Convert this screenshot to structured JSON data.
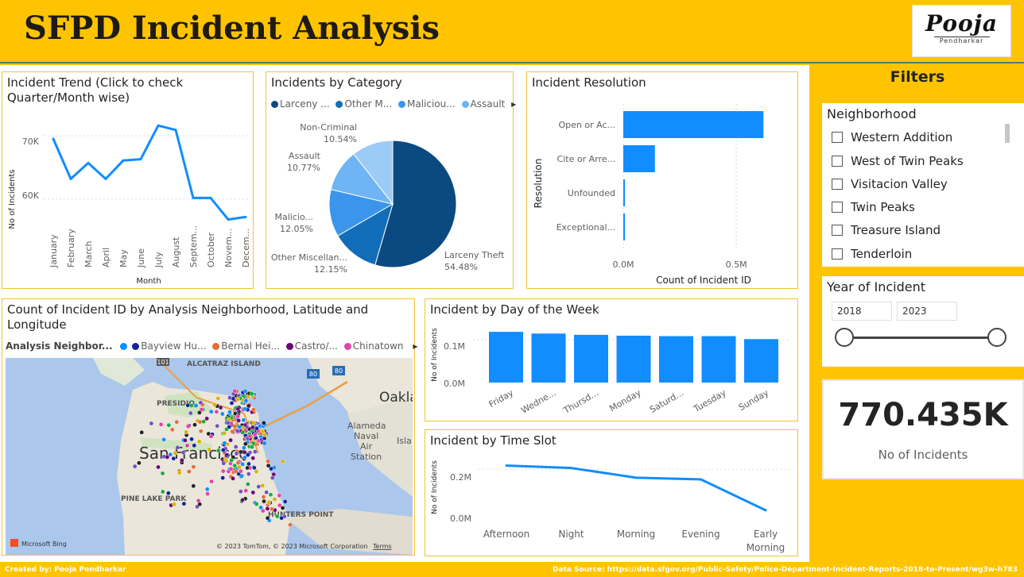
{
  "header": {
    "title": "SFPD Incident Analysis",
    "logo_name": "Pooja",
    "logo_sub": "Pendharkar"
  },
  "trend": {
    "title": "Incident Trend (Click to check Quarter/Month wise)",
    "ylabel": "No of Incidents",
    "xlabel": "Month",
    "yticks": [
      "70K",
      "60K"
    ]
  },
  "category": {
    "title": "Incidents by Category",
    "legend": [
      "Larceny ...",
      "Other M...",
      "Maliciou...",
      "Assault"
    ],
    "labels": [
      {
        "name": "Larceny Theft",
        "pct": "54.48%"
      },
      {
        "name": "Other Miscellan...",
        "pct": "12.15%"
      },
      {
        "name": "Malicio...",
        "pct": "12.05%"
      },
      {
        "name": "Assault",
        "pct": "10.77%"
      },
      {
        "name": "Non-Criminal",
        "pct": "10.54%"
      }
    ]
  },
  "resolution": {
    "title": "Incident Resolution",
    "ylabel": "Resolution",
    "xlabel": "Count of Incident ID",
    "xticks": [
      "0.0M",
      "0.5M"
    ]
  },
  "map": {
    "title": "Count of Incident ID by Analysis Neighborhood, Latitude and Longitude",
    "legend_label": "Analysis Neighbor...",
    "legend": [
      "Bayview Hu...",
      "Bernal Hei...",
      "Castro/...",
      "Chinatown"
    ],
    "places": [
      "ALCATRAZ ISLAND",
      "PRESIDIO",
      "San Francisco",
      "PINE LAKE PARK",
      "HUNTERS POINT",
      "Oakla",
      "Alameda",
      "Naval",
      "Air",
      "Station",
      "Isla"
    ],
    "highways": [
      "101",
      "80",
      "80"
    ],
    "bing": "Microsoft Bing",
    "copyright": "© 2023 TomTom, © 2023 Microsoft Corporation",
    "terms": "Terms"
  },
  "weekday": {
    "title": "Incident by Day of the Week",
    "ylabel": "No of Incidents",
    "yticks": [
      "0.1M",
      "0.0M"
    ]
  },
  "timeslot": {
    "title": "Incident by Time Slot",
    "ylabel": "No of Incidents",
    "yticks": [
      "0.2M",
      "0.0M"
    ]
  },
  "filters": {
    "title": "Filters",
    "neighborhood_title": "Neighborhood",
    "neighborhoods": [
      "Western Addition",
      "West of Twin Peaks",
      "Visitacion Valley",
      "Twin Peaks",
      "Treasure Island",
      "Tenderloin"
    ],
    "year_title": "Year of Incident",
    "year_from": "2018",
    "year_to": "2023",
    "year_range": [
      2018,
      2023
    ]
  },
  "kpi": {
    "value": "770.435K",
    "label": "No of Incidents"
  },
  "footer": {
    "created_by": "Created by: Pooja Pendharkar",
    "source": "Data Source: https://data.sfgov.org/Public-Safety/Police-Department-Incident-Reports-2018-to-Present/wg3w-h783"
  },
  "colors": {
    "accent": "#FFC400",
    "bar": "#118DFF",
    "dark_blue": "#0B4A80"
  },
  "chart_data": [
    {
      "type": "line",
      "title": "Incident Trend (Click to check Quarter/Month wise)",
      "xlabel": "Month",
      "ylabel": "No of Incidents",
      "categories": [
        "January",
        "February",
        "March",
        "April",
        "May",
        "June",
        "July",
        "August",
        "Septem...",
        "October",
        "Novem...",
        "Decem..."
      ],
      "values": [
        69500,
        63200,
        65700,
        63200,
        66100,
        66300,
        71600,
        70900,
        60200,
        60200,
        56800,
        57200
      ],
      "ylim": [
        55000,
        75000
      ],
      "yticks": [
        60000,
        70000
      ]
    },
    {
      "type": "pie",
      "title": "Incidents by Category",
      "labels": [
        "Larceny Theft",
        "Other Miscellan...",
        "Malicio...",
        "Assault",
        "Non-Criminal"
      ],
      "values": [
        54.48,
        12.15,
        12.05,
        10.77,
        10.54
      ],
      "colors": [
        "#0B4A80",
        "#126DB8",
        "#3B96EB",
        "#6FB4F4",
        "#9DCBF8"
      ]
    },
    {
      "type": "bar",
      "orientation": "horizontal",
      "title": "Incident Resolution",
      "xlabel": "Count of Incident ID",
      "ylabel": "Resolution",
      "categories": [
        "Open or Ac...",
        "Cite or Arre...",
        "Unfounded",
        "Exceptional..."
      ],
      "values": [
        620000,
        140000,
        6000,
        4000
      ],
      "xlim": [
        0,
        700000
      ],
      "xticks": [
        0,
        500000
      ]
    },
    {
      "type": "bar",
      "title": "Incident by Day of the Week",
      "ylabel": "No of Incidents",
      "categories": [
        "Friday",
        "Wedne...",
        "Thursd...",
        "Monday",
        "Saturd...",
        "Tuesday",
        "Sunday"
      ],
      "values": [
        118000,
        114000,
        111000,
        109000,
        108000,
        108000,
        101000
      ],
      "ylim": [
        0,
        120000
      ],
      "yticks": [
        0,
        100000
      ]
    },
    {
      "type": "line",
      "title": "Incident by Time Slot",
      "ylabel": "No of Incidents",
      "categories": [
        "Afternoon",
        "Night",
        "Morning",
        "Evening",
        "Early Morning"
      ],
      "values": [
        215000,
        205000,
        165000,
        158000,
        30000
      ],
      "ylim": [
        0,
        250000
      ],
      "yticks": [
        0,
        200000
      ]
    }
  ]
}
